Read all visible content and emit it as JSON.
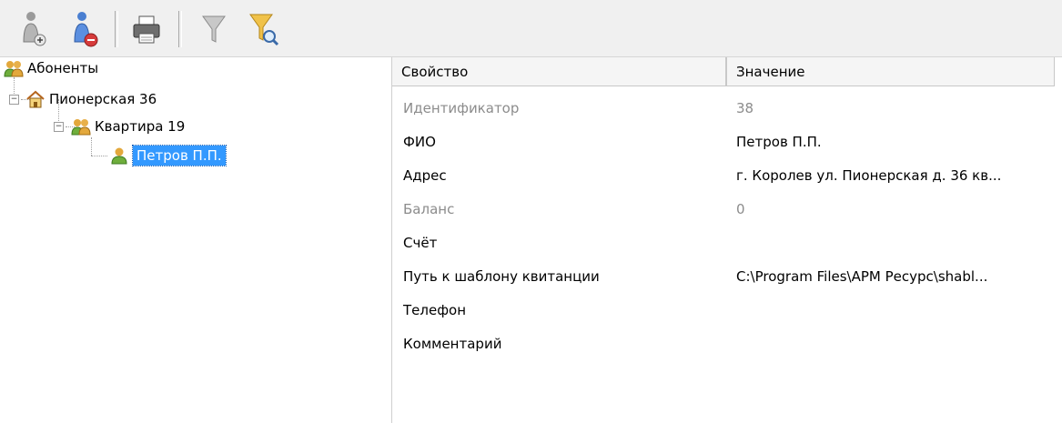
{
  "toolbar": {
    "buttons": [
      {
        "name": "add-subscriber",
        "icon": "user-add-icon"
      },
      {
        "name": "remove-subscriber",
        "icon": "user-remove-icon"
      },
      {
        "name": "print",
        "icon": "printer-icon"
      },
      {
        "name": "filter",
        "icon": "funnel-icon"
      },
      {
        "name": "filter-search",
        "icon": "funnel-search-icon"
      }
    ]
  },
  "tree": {
    "root": "Абоненты",
    "building": "Пионерская 36",
    "apartment": "Квартира 19",
    "person": "Петров П.П."
  },
  "grid": {
    "headers": {
      "property": "Свойство",
      "value": "Значение"
    },
    "rows": [
      {
        "key": "Идентификатор",
        "value": "38",
        "readonly": true
      },
      {
        "key": "ФИО",
        "value": "Петров П.П.",
        "readonly": false
      },
      {
        "key": "Адрес",
        "value": "г. Королев ул. Пионерская д. 36 кв...",
        "readonly": false
      },
      {
        "key": "Баланс",
        "value": "0",
        "readonly": true
      },
      {
        "key": "Счёт",
        "value": "",
        "readonly": false
      },
      {
        "key": "Путь к шаблону квитанции",
        "value": "C:\\Program Files\\АРМ Ресурс\\shabl...",
        "readonly": false
      },
      {
        "key": "Телефон",
        "value": "",
        "readonly": false
      },
      {
        "key": "Комментарий",
        "value": "",
        "readonly": false
      }
    ]
  },
  "colors": {
    "selection": "#3399ff",
    "toolbar_bg": "#f0f0f0",
    "dim_text": "#8c8c8c",
    "header_bg": "#f5f5f5"
  }
}
